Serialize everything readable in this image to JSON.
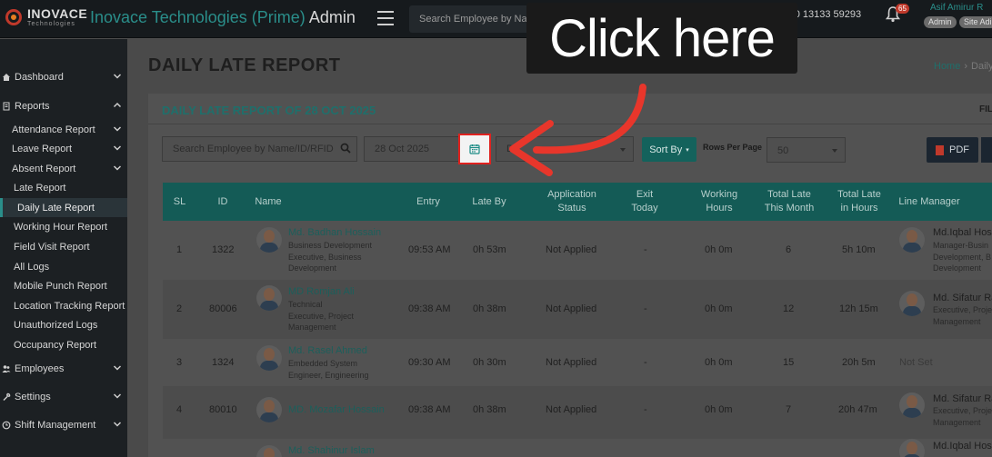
{
  "header": {
    "logo_line1": "INOVACE",
    "logo_line2": "Technologies",
    "app_title": "Inovace Technologies (Prime)",
    "app_title_suffix": "Admin",
    "search_placeholder": "Search Employee by Name",
    "phone": "+880 13133 59293",
    "notification_count": "65",
    "user_name": "Asif Amirur R",
    "roles": [
      "Admin",
      "Site Adi"
    ]
  },
  "sidebar": {
    "items": [
      {
        "label": "Dashboard",
        "level": "main",
        "icon": "home-icon"
      },
      {
        "label": "Reports",
        "level": "main",
        "icon": "report-icon",
        "expanded": true
      },
      {
        "label": "Attendance Report",
        "level": "sub"
      },
      {
        "label": "Leave Report",
        "level": "sub"
      },
      {
        "label": "Absent Report",
        "level": "sub",
        "expanded": true
      },
      {
        "label": "Late Report",
        "level": "leaf"
      },
      {
        "label": "Daily Late Report",
        "level": "leaf",
        "active": true
      },
      {
        "label": "Working Hour Report",
        "level": "leaf"
      },
      {
        "label": "Field Visit Report",
        "level": "leaf"
      },
      {
        "label": "All Logs",
        "level": "leaf"
      },
      {
        "label": "Mobile Punch Report",
        "level": "leaf"
      },
      {
        "label": "Location Tracking Report",
        "level": "leaf"
      },
      {
        "label": "Unauthorized Logs",
        "level": "leaf"
      },
      {
        "label": "Occupancy Report",
        "level": "leaf"
      },
      {
        "label": "Employees",
        "level": "main",
        "icon": "users-icon"
      },
      {
        "label": "Settings",
        "level": "main",
        "icon": "wrench-icon"
      },
      {
        "label": "Shift Management",
        "level": "main",
        "icon": "clock-icon"
      }
    ]
  },
  "page": {
    "title": "DAILY LATE REPORT",
    "breadcrumb_home": "Home",
    "breadcrumb_current": "Daily",
    "card_title": "DAILY LATE REPORT OF 28 OCT 2025",
    "filter_link": "FIL"
  },
  "filters": {
    "search_placeholder": "Search Employee by Name/ID/RFID",
    "date_value": "28 Oct 2025",
    "department_placeholder": "De",
    "sort_label": "Sort By",
    "rows_per_page_label": "Rows Per Page",
    "rows_per_page_value": "50",
    "pdf_label": "PDF"
  },
  "table": {
    "columns": [
      "SL",
      "ID",
      "Name",
      "Entry",
      "Late By",
      "Application Status",
      "Exit Today",
      "Working Hours",
      "Total Late This Month",
      "Total Late in Hours",
      "Line Manager"
    ],
    "rows": [
      {
        "sl": "1",
        "id": "1322",
        "name": "Md. Badhan Hossain",
        "designation": "Business Development Executive, Business Development",
        "entry": "09:53 AM",
        "late_by": "0h 53m",
        "status": "Not Applied",
        "exit": "-",
        "working": "0h 0m",
        "late_month": "6",
        "late_hours": "5h 10m",
        "manager_name": "Md.Iqbal Hos",
        "manager_desig": [
          "Manager-Busin",
          "Development, B",
          "Development"
        ]
      },
      {
        "sl": "2",
        "id": "80006",
        "name": "MD Romjan Ali",
        "designation": "Technical Executive, Project Management",
        "entry": "09:38 AM",
        "late_by": "0h 38m",
        "status": "Not Applied",
        "exit": "-",
        "working": "0h 0m",
        "late_month": "12",
        "late_hours": "12h 15m",
        "manager_name": "Md. Sifatur Ra",
        "manager_desig": [
          "Executive, Proje",
          "Management"
        ]
      },
      {
        "sl": "3",
        "id": "1324",
        "name": "Md. Rasel Ahmed",
        "designation": "Embedded System Engineer, Engineering",
        "entry": "09:30 AM",
        "late_by": "0h 30m",
        "status": "Not Applied",
        "exit": "-",
        "working": "0h 0m",
        "late_month": "15",
        "late_hours": "20h 5m",
        "manager_name": "Not Set",
        "manager_desig": []
      },
      {
        "sl": "4",
        "id": "80010",
        "name": "MD. Mozafar Hossain",
        "designation": "",
        "entry": "09:38 AM",
        "late_by": "0h 38m",
        "status": "Not Applied",
        "exit": "-",
        "working": "0h 0m",
        "late_month": "7",
        "late_hours": "20h 47m",
        "manager_name": "Md. Sifatur Ra",
        "manager_desig": [
          "Executive, Proje",
          "Management"
        ]
      },
      {
        "sl": "",
        "id": "",
        "name": "Md. Shahinur Islam",
        "designation": "",
        "entry": "",
        "late_by": "",
        "status": "",
        "exit": "",
        "working": "",
        "late_month": "",
        "late_hours": "",
        "manager_name": "Md.Iqbal Hos",
        "manager_desig": []
      }
    ]
  },
  "annotation": {
    "callout_text": "Click here"
  },
  "colors": {
    "accent": "#2a8e8a",
    "table_header": "#145b56",
    "highlight_box": "#e0221f",
    "arrow": "#e8362b"
  }
}
